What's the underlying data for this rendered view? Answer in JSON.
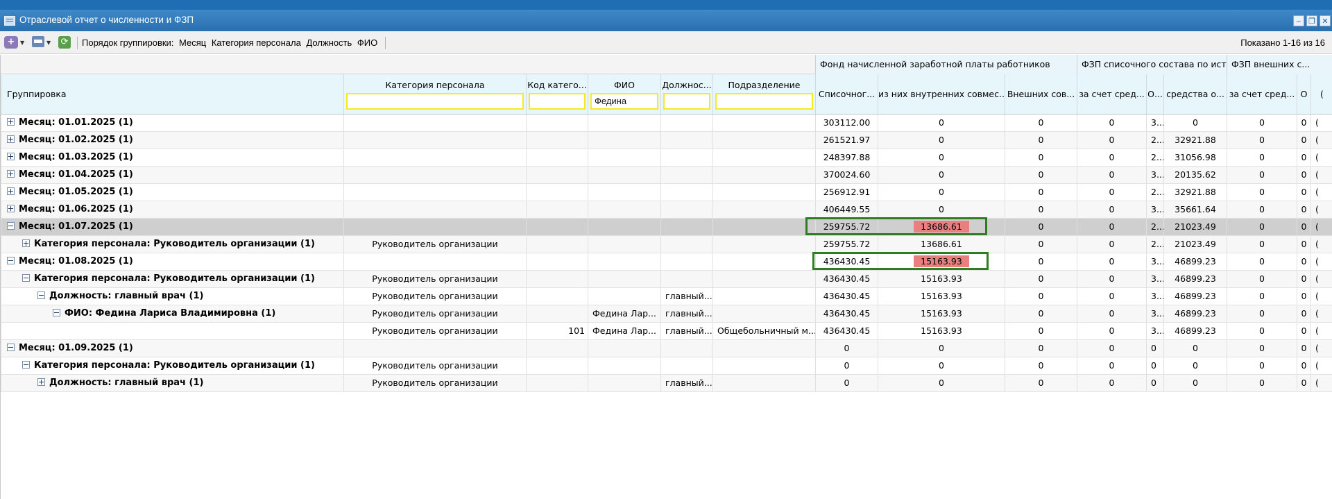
{
  "window": {
    "title": "Отраслевой отчет о численности и ФЗП",
    "minimize": "‒",
    "restore": "❐",
    "close": "✕"
  },
  "toolbar": {
    "add_icon": "+",
    "refresh_icon": "⟳",
    "group_order_label": "Порядок группировки:",
    "group_order_items": [
      "Месяц",
      "Категория персонала",
      "Должность",
      "ФИО"
    ],
    "shown": "Показано 1-16 из 16"
  },
  "header": {
    "groups": {
      "fund": "Фонд начисленной заработной платы работников",
      "fzp_list": "ФЗП списочного состава по ист...",
      "fzp_ext": "ФЗП внешних с..."
    },
    "columns": {
      "grouping": "Группировка",
      "category": "Категория персонала",
      "code": "Код катего...",
      "fio": "ФИО",
      "position": "Должнос...",
      "department": "Подразделение",
      "list_total": "Списочног...",
      "internal": "из них внутренних совмес...",
      "external": "Внешних сов...",
      "fund_means": "за счет сред...",
      "o1": "О...",
      "means_o": "средства о...",
      "ext_means": "за счет сред...",
      "o2": "О",
      "o3": "("
    },
    "filters": {
      "category": "",
      "code": "",
      "fio": "Федина",
      "position": "",
      "department": ""
    }
  },
  "rows": [
    {
      "indent": 0,
      "exp": "plus",
      "label": "Месяц: 01.01.2025 (1)",
      "category": "",
      "code": "",
      "fio": "",
      "position": "",
      "department": "",
      "list_total": "303112.00",
      "internal": "0",
      "external": "0",
      "fund_means": "0",
      "o1": "3...",
      "means_o": "0",
      "ext_means": "0",
      "o2": "0",
      "o3": "("
    },
    {
      "indent": 0,
      "exp": "plus",
      "label": "Месяц: 01.02.2025 (1)",
      "category": "",
      "code": "",
      "fio": "",
      "position": "",
      "department": "",
      "list_total": "261521.97",
      "internal": "0",
      "external": "0",
      "fund_means": "0",
      "o1": "2...",
      "means_o": "32921.88",
      "ext_means": "0",
      "o2": "0",
      "o3": "("
    },
    {
      "indent": 0,
      "exp": "plus",
      "label": "Месяц: 01.03.2025 (1)",
      "category": "",
      "code": "",
      "fio": "",
      "position": "",
      "department": "",
      "list_total": "248397.88",
      "internal": "0",
      "external": "0",
      "fund_means": "0",
      "o1": "2...",
      "means_o": "31056.98",
      "ext_means": "0",
      "o2": "0",
      "o3": "("
    },
    {
      "indent": 0,
      "exp": "plus",
      "label": "Месяц: 01.04.2025 (1)",
      "category": "",
      "code": "",
      "fio": "",
      "position": "",
      "department": "",
      "list_total": "370024.60",
      "internal": "0",
      "external": "0",
      "fund_means": "0",
      "o1": "3...",
      "means_o": "20135.62",
      "ext_means": "0",
      "o2": "0",
      "o3": "("
    },
    {
      "indent": 0,
      "exp": "plus",
      "label": "Месяц: 01.05.2025 (1)",
      "category": "",
      "code": "",
      "fio": "",
      "position": "",
      "department": "",
      "list_total": "256912.91",
      "internal": "0",
      "external": "0",
      "fund_means": "0",
      "o1": "2...",
      "means_o": "32921.88",
      "ext_means": "0",
      "o2": "0",
      "o3": "("
    },
    {
      "indent": 0,
      "exp": "plus",
      "label": "Месяц: 01.06.2025 (1)",
      "category": "",
      "code": "",
      "fio": "",
      "position": "",
      "department": "",
      "list_total": "406449.55",
      "internal": "0",
      "external": "0",
      "fund_means": "0",
      "o1": "3...",
      "means_o": "35661.64",
      "ext_means": "0",
      "o2": "0",
      "o3": "("
    },
    {
      "indent": 0,
      "exp": "minus",
      "label": "Месяц: 01.07.2025 (1)",
      "category": "",
      "code": "",
      "fio": "",
      "position": "",
      "department": "",
      "list_total": "259755.72",
      "internal": "13686.61",
      "external": "0",
      "fund_means": "0",
      "o1": "2...",
      "means_o": "21023.49",
      "ext_means": "0",
      "o2": "0",
      "o3": "(",
      "selected": true,
      "highlight": true
    },
    {
      "indent": 1,
      "exp": "plus",
      "label": "Категория персонала: Руководитель организации (1)",
      "category": "Руководитель организации",
      "code": "",
      "fio": "",
      "position": "",
      "department": "",
      "list_total": "259755.72",
      "internal": "13686.61",
      "external": "0",
      "fund_means": "0",
      "o1": "2...",
      "means_o": "21023.49",
      "ext_means": "0",
      "o2": "0",
      "o3": "("
    },
    {
      "indent": 0,
      "exp": "minus",
      "label": "Месяц: 01.08.2025 (1)",
      "category": "",
      "code": "",
      "fio": "",
      "position": "",
      "department": "",
      "list_total": "436430.45",
      "internal": "15163.93",
      "external": "0",
      "fund_means": "0",
      "o1": "3...",
      "means_o": "46899.23",
      "ext_means": "0",
      "o2": "0",
      "o3": "(",
      "highlight": true
    },
    {
      "indent": 1,
      "exp": "minus",
      "label": "Категория персонала: Руководитель организации (1)",
      "category": "Руководитель организации",
      "code": "",
      "fio": "",
      "position": "",
      "department": "",
      "list_total": "436430.45",
      "internal": "15163.93",
      "external": "0",
      "fund_means": "0",
      "o1": "3...",
      "means_o": "46899.23",
      "ext_means": "0",
      "o2": "0",
      "o3": "("
    },
    {
      "indent": 2,
      "exp": "minus",
      "label": "Должность: главный врач (1)",
      "category": "Руководитель организации",
      "code": "",
      "fio": "",
      "position": "главный...",
      "department": "",
      "list_total": "436430.45",
      "internal": "15163.93",
      "external": "0",
      "fund_means": "0",
      "o1": "3...",
      "means_o": "46899.23",
      "ext_means": "0",
      "o2": "0",
      "o3": "("
    },
    {
      "indent": 3,
      "exp": "minus",
      "label": "ФИО: Федина Лариса Владимировна (1)",
      "category": "Руководитель организации",
      "code": "",
      "fio": "Федина Лар...",
      "position": "главный...",
      "department": "",
      "list_total": "436430.45",
      "internal": "15163.93",
      "external": "0",
      "fund_means": "0",
      "o1": "3...",
      "means_o": "46899.23",
      "ext_means": "0",
      "o2": "0",
      "o3": "("
    },
    {
      "indent": 4,
      "exp": "",
      "label": "",
      "category": "Руководитель организации",
      "code": "101",
      "fio": "Федина Лар...",
      "position": "главный...",
      "department": "Общебольничный м...",
      "list_total": "436430.45",
      "internal": "15163.93",
      "external": "0",
      "fund_means": "0",
      "o1": "3...",
      "means_o": "46899.23",
      "ext_means": "0",
      "o2": "0",
      "o3": "("
    },
    {
      "indent": 0,
      "exp": "minus",
      "label": "Месяц: 01.09.2025 (1)",
      "category": "",
      "code": "",
      "fio": "",
      "position": "",
      "department": "",
      "list_total": "0",
      "internal": "0",
      "external": "0",
      "fund_means": "0",
      "o1": "0",
      "means_o": "0",
      "ext_means": "0",
      "o2": "0",
      "o3": "("
    },
    {
      "indent": 1,
      "exp": "minus",
      "label": "Категория персонала: Руководитель организации (1)",
      "category": "Руководитель организации",
      "code": "",
      "fio": "",
      "position": "",
      "department": "",
      "list_total": "0",
      "internal": "0",
      "external": "0",
      "fund_means": "0",
      "o1": "0",
      "means_o": "0",
      "ext_means": "0",
      "o2": "0",
      "o3": "("
    },
    {
      "indent": 2,
      "exp": "plus",
      "label": "Должность: главный врач (1)",
      "category": "Руководитель организации",
      "code": "",
      "fio": "",
      "position": "главный...",
      "department": "",
      "list_total": "0",
      "internal": "0",
      "external": "0",
      "fund_means": "0",
      "o1": "0",
      "means_o": "0",
      "ext_means": "0",
      "o2": "0",
      "o3": "("
    }
  ],
  "colors": {
    "title_bar": "#2a6fb0",
    "filter_border": "#f7ea22",
    "highlight_red": "#e88080",
    "highlight_box": "#2e7d1e",
    "selected_row": "#cfcfcf"
  }
}
